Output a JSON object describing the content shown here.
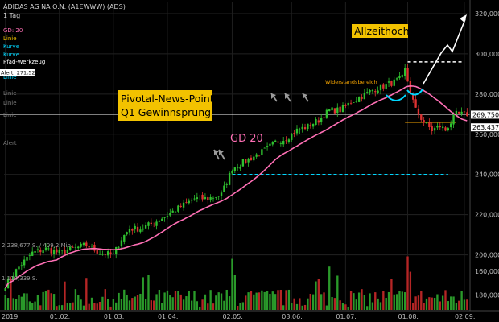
{
  "header": {
    "title": "ADIDAS AG NA O.N. (A1EWWW) (ADS)",
    "interval": "1 Tag"
  },
  "indicators": [
    {
      "label": "GD: 20",
      "color": "#ff6fb5"
    },
    {
      "label": "Linie",
      "color": "#f2c200"
    },
    {
      "label": "Kurve",
      "color": "#00d7ff"
    },
    {
      "label": "Kurve",
      "color": "#00d7ff"
    },
    {
      "label": "Pfad-Werkzeug",
      "color": "#ffffff"
    },
    {
      "label": "Linie",
      "color": "#00d7ff"
    },
    {
      "label": "Linie",
      "color": "#7a7a7a"
    },
    {
      "label": "Linie",
      "color": "#7a7a7a"
    },
    {
      "label": "Linie",
      "color": "#7a7a7a"
    },
    {
      "label": "Alert",
      "color": "#7a7a7a"
    }
  ],
  "alert_tag": "Alert: 271,521",
  "volume_labels": [
    "2.238,677 S. / 409,2 Mio.",
    "1.110,339 S."
  ],
  "chart_data": {
    "type": "candlestick",
    "title": "ADIDAS AG NA O.N. (A1EWWW) (ADS)",
    "ylim": [
      173,
      326
    ],
    "yticks": [
      180,
      200,
      220,
      240,
      260,
      280,
      300,
      320
    ],
    "ytick_labels": [
      "180,000",
      "200,000",
      "220,000",
      "240,000",
      "260,000",
      "280,000",
      "300,000",
      "320,000"
    ],
    "y_badges": [
      {
        "label": "269,750",
        "value": 269.75,
        "color": "#ffffff"
      },
      {
        "label": "263,437",
        "value": 263.437,
        "color": "#ffffff"
      }
    ],
    "volume_tick": {
      "label": "160,000",
      "value": 160
    },
    "xticks": [
      "2019",
      "01.02.",
      "01.03.",
      "01.04.",
      "02.05.",
      "03.06.",
      "01.07.",
      "01.08.",
      "02.09."
    ],
    "xtick_index": [
      0,
      20,
      40,
      60,
      84,
      106,
      126,
      149,
      170
    ],
    "colors": {
      "up": "#2fc12f",
      "down": "#e03232",
      "ma": "#ff6fb5",
      "annotation": "#f2c200",
      "cyan": "#00d7ff",
      "volume_up": "#2a9a2a",
      "volume_down": "#b52525"
    },
    "close_anchors": [
      [
        0,
        185
      ],
      [
        5,
        194
      ],
      [
        10,
        201
      ],
      [
        15,
        203
      ],
      [
        20,
        201
      ],
      [
        25,
        203
      ],
      [
        30,
        205
      ],
      [
        35,
        201
      ],
      [
        40,
        200
      ],
      [
        43,
        208
      ],
      [
        46,
        213
      ],
      [
        50,
        213
      ],
      [
        55,
        216
      ],
      [
        60,
        220
      ],
      [
        65,
        224
      ],
      [
        70,
        228
      ],
      [
        75,
        228
      ],
      [
        80,
        230
      ],
      [
        84,
        243
      ],
      [
        88,
        246
      ],
      [
        92,
        249
      ],
      [
        96,
        252
      ],
      [
        100,
        256
      ],
      [
        104,
        258
      ],
      [
        108,
        262
      ],
      [
        112,
        264
      ],
      [
        116,
        267
      ],
      [
        120,
        272
      ],
      [
        124,
        272
      ],
      [
        128,
        276
      ],
      [
        132,
        279
      ],
      [
        136,
        282
      ],
      [
        140,
        284
      ],
      [
        144,
        286
      ],
      [
        147,
        288
      ],
      [
        148,
        292
      ],
      [
        150,
        281
      ],
      [
        152,
        272
      ],
      [
        155,
        266
      ],
      [
        158,
        262
      ],
      [
        161,
        264
      ],
      [
        163,
        262
      ],
      [
        165,
        266
      ],
      [
        167,
        270
      ]
    ],
    "ma_label": "GD 20",
    "annotations": [
      {
        "text": "Pivotal-News-Point",
        "line2": "Q1 Gewinnsprung"
      },
      {
        "text": "Allzeithoch"
      }
    ],
    "resistance_label": "Widerstandsbereich",
    "levels": [
      {
        "name": "support",
        "value": 240,
        "style": "dashed",
        "color": "#00d7ff"
      },
      {
        "name": "ath",
        "value": 296,
        "style": "dashed",
        "color": "#ffffff"
      },
      {
        "name": "resistance",
        "value": 266,
        "style": "solid",
        "color": "#f2a200"
      }
    ]
  }
}
